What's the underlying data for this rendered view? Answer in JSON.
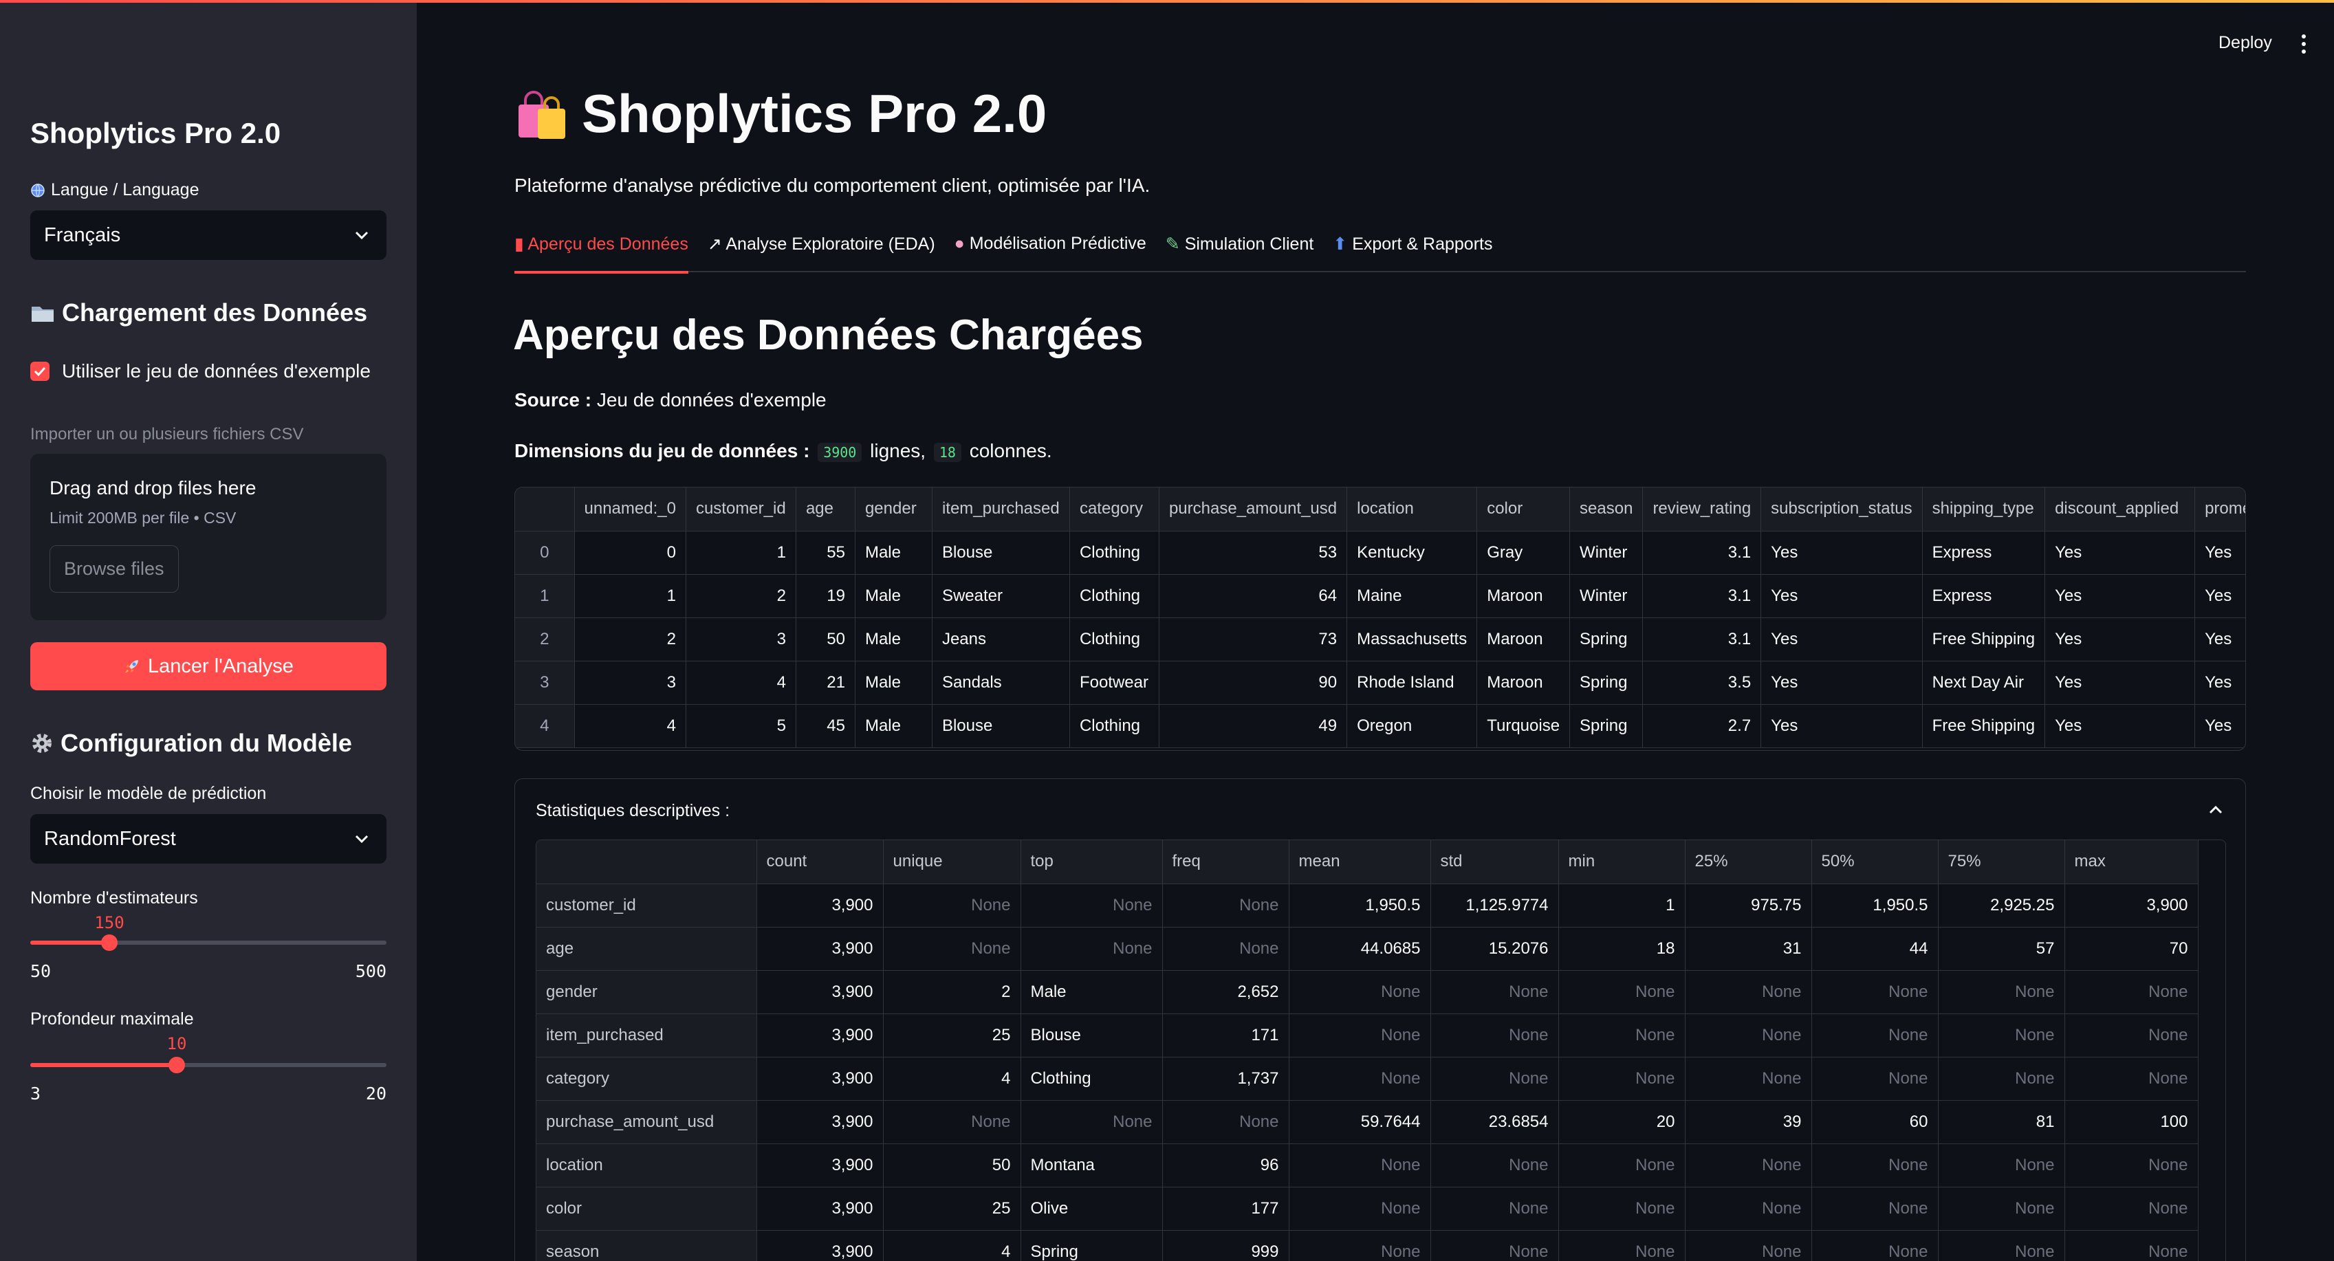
{
  "sidebar": {
    "title": "Shoplytics Pro 2.0",
    "language_label": "Langue / Language",
    "language_value": "Français",
    "data_section_title": "Chargement des Données",
    "use_example_label": "Utiliser le jeu de données d'exemple",
    "import_label": "Importer un ou plusieurs fichiers CSV",
    "dropzone_title": "Drag and drop files here",
    "dropzone_sub": "Limit 200MB per file • CSV",
    "browse_label": "Browse files",
    "launch_label": "Lancer l'Analyse",
    "model_section_title": "Configuration du Modèle",
    "model_choice_label": "Choisir le modèle de prédiction",
    "model_value": "RandomForest",
    "estimators": {
      "label": "Nombre d'estimateurs",
      "value": "150",
      "min": "50",
      "max": "500",
      "fraction": 0.222
    },
    "max_depth": {
      "label": "Profondeur maximale",
      "value": "10",
      "min": "3",
      "max": "20",
      "fraction": 0.412
    }
  },
  "header": {
    "deploy_label": "Deploy"
  },
  "main": {
    "title": "Shoplytics Pro 2.0",
    "subtitle": "Plateforme d'analyse prédictive du comportement client, optimisée par l'IA.",
    "tabs": [
      {
        "label": "Aperçu des Données",
        "icon": "chart-icon"
      },
      {
        "label": "Analyse Exploratoire (EDA)",
        "icon": "trend-icon"
      },
      {
        "label": "Modélisation Prédictive",
        "icon": "brain-icon"
      },
      {
        "label": "Simulation Client",
        "icon": "pencil-icon"
      },
      {
        "label": "Export & Rapports",
        "icon": "export-icon"
      }
    ],
    "section_title": "Aperçu des Données Chargées",
    "source_label": "Source :",
    "source_value": "Jeu de données d'exemple",
    "dims_label": "Dimensions du jeu de données :",
    "dims_rows": "3900",
    "dims_rows_word": "lignes,",
    "dims_cols": "18",
    "dims_cols_word": "colonnes."
  },
  "dataframe": {
    "columns": [
      "",
      "unnamed:_0",
      "customer_id",
      "age",
      "gender",
      "item_purchased",
      "category",
      "purchase_amount_usd",
      "location",
      "color",
      "season",
      "review_rating",
      "subscription_status",
      "shipping_type",
      "discount_applied",
      "prome"
    ],
    "rows": [
      [
        "0",
        "0",
        "1",
        "55",
        "Male",
        "Blouse",
        "Clothing",
        "53",
        "Kentucky",
        "Gray",
        "Winter",
        "3.1",
        "Yes",
        "Express",
        "Yes",
        "Yes"
      ],
      [
        "1",
        "1",
        "2",
        "19",
        "Male",
        "Sweater",
        "Clothing",
        "64",
        "Maine",
        "Maroon",
        "Winter",
        "3.1",
        "Yes",
        "Express",
        "Yes",
        "Yes"
      ],
      [
        "2",
        "2",
        "3",
        "50",
        "Male",
        "Jeans",
        "Clothing",
        "73",
        "Massachusetts",
        "Maroon",
        "Spring",
        "3.1",
        "Yes",
        "Free Shipping",
        "Yes",
        "Yes"
      ],
      [
        "3",
        "3",
        "4",
        "21",
        "Male",
        "Sandals",
        "Footwear",
        "90",
        "Rhode Island",
        "Maroon",
        "Spring",
        "3.5",
        "Yes",
        "Next Day Air",
        "Yes",
        "Yes"
      ],
      [
        "4",
        "4",
        "5",
        "45",
        "Male",
        "Blouse",
        "Clothing",
        "49",
        "Oregon",
        "Turquoise",
        "Spring",
        "2.7",
        "Yes",
        "Free Shipping",
        "Yes",
        "Yes"
      ]
    ]
  },
  "stats": {
    "title": "Statistiques descriptives :",
    "columns": [
      "",
      "count",
      "unique",
      "top",
      "freq",
      "mean",
      "std",
      "min",
      "25%",
      "50%",
      "75%",
      "max"
    ],
    "rows": [
      [
        "customer_id",
        "3,900",
        "None",
        "None",
        "None",
        "1,950.5",
        "1,125.9774",
        "1",
        "975.75",
        "1,950.5",
        "2,925.25",
        "3,900"
      ],
      [
        "age",
        "3,900",
        "None",
        "None",
        "None",
        "44.0685",
        "15.2076",
        "18",
        "31",
        "44",
        "57",
        "70"
      ],
      [
        "gender",
        "3,900",
        "2",
        "Male",
        "2,652",
        "None",
        "None",
        "None",
        "None",
        "None",
        "None",
        "None"
      ],
      [
        "item_purchased",
        "3,900",
        "25",
        "Blouse",
        "171",
        "None",
        "None",
        "None",
        "None",
        "None",
        "None",
        "None"
      ],
      [
        "category",
        "3,900",
        "4",
        "Clothing",
        "1,737",
        "None",
        "None",
        "None",
        "None",
        "None",
        "None",
        "None"
      ],
      [
        "purchase_amount_usd",
        "3,900",
        "None",
        "None",
        "None",
        "59.7644",
        "23.6854",
        "20",
        "39",
        "60",
        "81",
        "100"
      ],
      [
        "location",
        "3,900",
        "50",
        "Montana",
        "96",
        "None",
        "None",
        "None",
        "None",
        "None",
        "None",
        "None"
      ],
      [
        "color",
        "3,900",
        "25",
        "Olive",
        "177",
        "None",
        "None",
        "None",
        "None",
        "None",
        "None",
        "None"
      ],
      [
        "season",
        "3,900",
        "4",
        "Spring",
        "999",
        "None",
        "None",
        "None",
        "None",
        "None",
        "None",
        "None"
      ]
    ]
  },
  "colors": {
    "accent": "#ff4b4b",
    "background": "#0e1117",
    "sidebar": "#262730"
  }
}
